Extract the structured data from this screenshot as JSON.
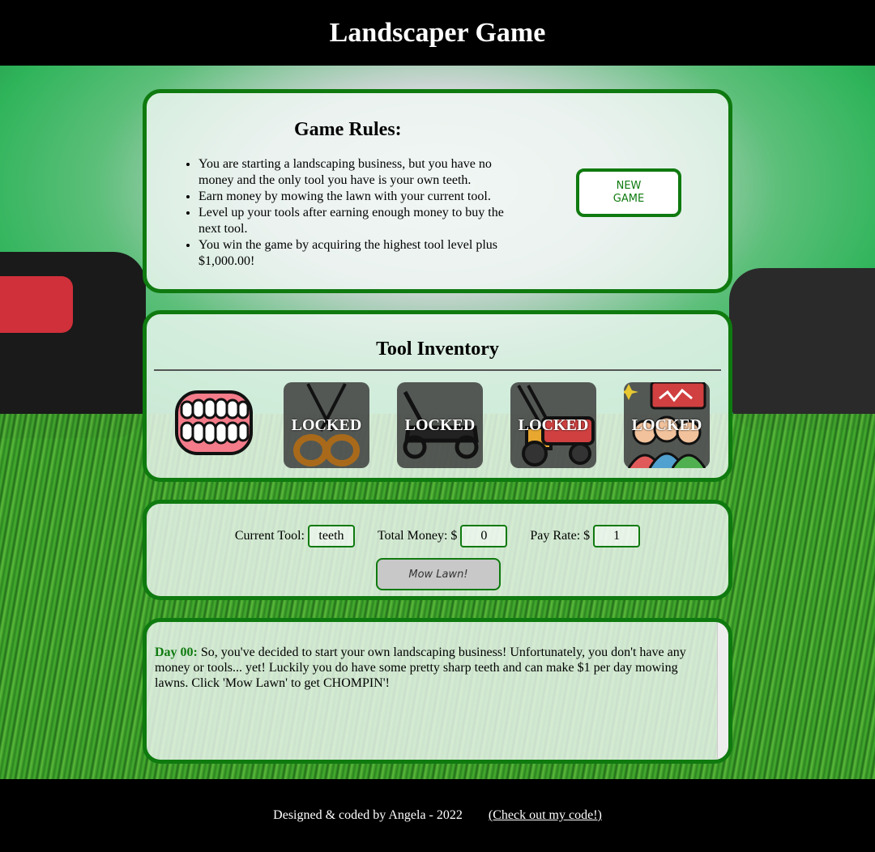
{
  "header": {
    "title": "Landscaper Game"
  },
  "rules": {
    "title": "Game Rules:",
    "items": [
      "You are starting a landscaping business, but you have no money and the only tool you have is your own teeth.",
      "Earn money by mowing the lawn with your current tool.",
      "Level up your tools after earning enough money to buy the next tool.",
      "You win the game by acquiring the highest tool level plus $1,000.00!"
    ],
    "new_game_label": "NEW GAME"
  },
  "inventory": {
    "title": "Tool Inventory",
    "locked_label": "LOCKED",
    "tools": [
      {
        "icon": "teeth-icon",
        "locked": false
      },
      {
        "icon": "scissors-icon",
        "locked": true
      },
      {
        "icon": "push-mower-icon",
        "locked": true
      },
      {
        "icon": "power-mower-icon",
        "locked": true
      },
      {
        "icon": "team-icon",
        "locked": true
      }
    ]
  },
  "status": {
    "current_tool_label": "Current Tool:",
    "current_tool_value": "teeth",
    "total_money_label": "Total Money: $",
    "total_money_value": "0",
    "pay_rate_label": "Pay Rate: $",
    "pay_rate_value": "1",
    "mow_label": "Mow Lawn!"
  },
  "log": {
    "day_label": "Day 00:",
    "message": "So, you've decided to start your own landscaping business! Unfortunately, you don't have any money or tools... yet! Luckily you do have some pretty sharp teeth and can make $1 per day mowing lawns. Click 'Mow Lawn' to get CHOMPIN'!"
  },
  "footer": {
    "credit": "Designed & coded by Angela - 2022",
    "link_label": "(Check out my code!)"
  },
  "colors": {
    "accent": "#0f7a0f",
    "header_bg": "#000000"
  }
}
